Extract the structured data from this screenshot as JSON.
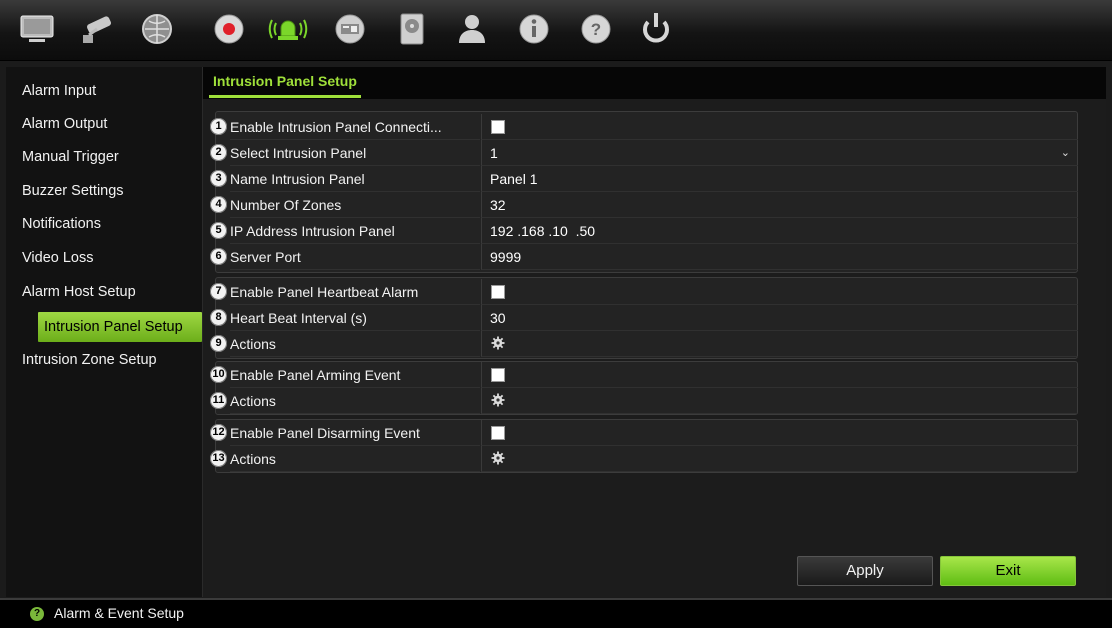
{
  "toolbar": {
    "icons": [
      "monitor-icon",
      "camera-icon",
      "network-icon",
      "record-icon",
      "alarm-icon",
      "device-icon",
      "hdd-icon",
      "user-icon",
      "info-icon",
      "help-icon",
      "power-icon"
    ],
    "active_icon": "alarm-icon"
  },
  "sidebar": {
    "items": [
      {
        "label": "Alarm Input"
      },
      {
        "label": "Alarm Output"
      },
      {
        "label": "Manual Trigger"
      },
      {
        "label": "Buzzer Settings"
      },
      {
        "label": "Notifications"
      },
      {
        "label": "Video Loss"
      },
      {
        "label": "Alarm Host Setup"
      },
      {
        "label": "Intrusion Panel Setup"
      },
      {
        "label": "Intrusion Zone Setup"
      }
    ],
    "active_index": 7
  },
  "tab": {
    "title": "Intrusion Panel Setup"
  },
  "rows": [
    {
      "num": "1",
      "label": "Enable Intrusion Panel Connecti...",
      "type": "checkbox",
      "checked": false
    },
    {
      "num": "2",
      "label": "Select Intrusion Panel",
      "type": "select",
      "value": "1"
    },
    {
      "num": "3",
      "label": "Name Intrusion Panel",
      "type": "text",
      "value": "Panel 1"
    },
    {
      "num": "4",
      "label": "Number Of Zones",
      "type": "text",
      "value": "32"
    },
    {
      "num": "5",
      "label": "IP Address Intrusion Panel",
      "type": "text",
      "value": "192 .168 .10  .50"
    },
    {
      "num": "6",
      "label": "Server Port",
      "type": "text",
      "value": "9999"
    },
    {
      "num": "7",
      "label": "Enable Panel Heartbeat Alarm",
      "type": "checkbox",
      "checked": false
    },
    {
      "num": "8",
      "label": "Heart Beat Interval (s)",
      "type": "text",
      "value": "30"
    },
    {
      "num": "9",
      "label": "Actions",
      "type": "gear"
    },
    {
      "num": "10",
      "label": "Enable Panel Arming Event",
      "type": "checkbox",
      "checked": false
    },
    {
      "num": "11",
      "label": "Actions",
      "type": "gear"
    },
    {
      "num": "12",
      "label": "Enable Panel Disarming Event",
      "type": "checkbox",
      "checked": false
    },
    {
      "num": "13",
      "label": "Actions",
      "type": "gear"
    }
  ],
  "buttons": {
    "apply": "Apply",
    "exit": "Exit"
  },
  "status": {
    "text": "Alarm & Event Setup",
    "icon": "question-icon"
  },
  "colors": {
    "accent": "#9fe03a",
    "active_item": "#8cc63f",
    "background": "#1c1c1c"
  }
}
